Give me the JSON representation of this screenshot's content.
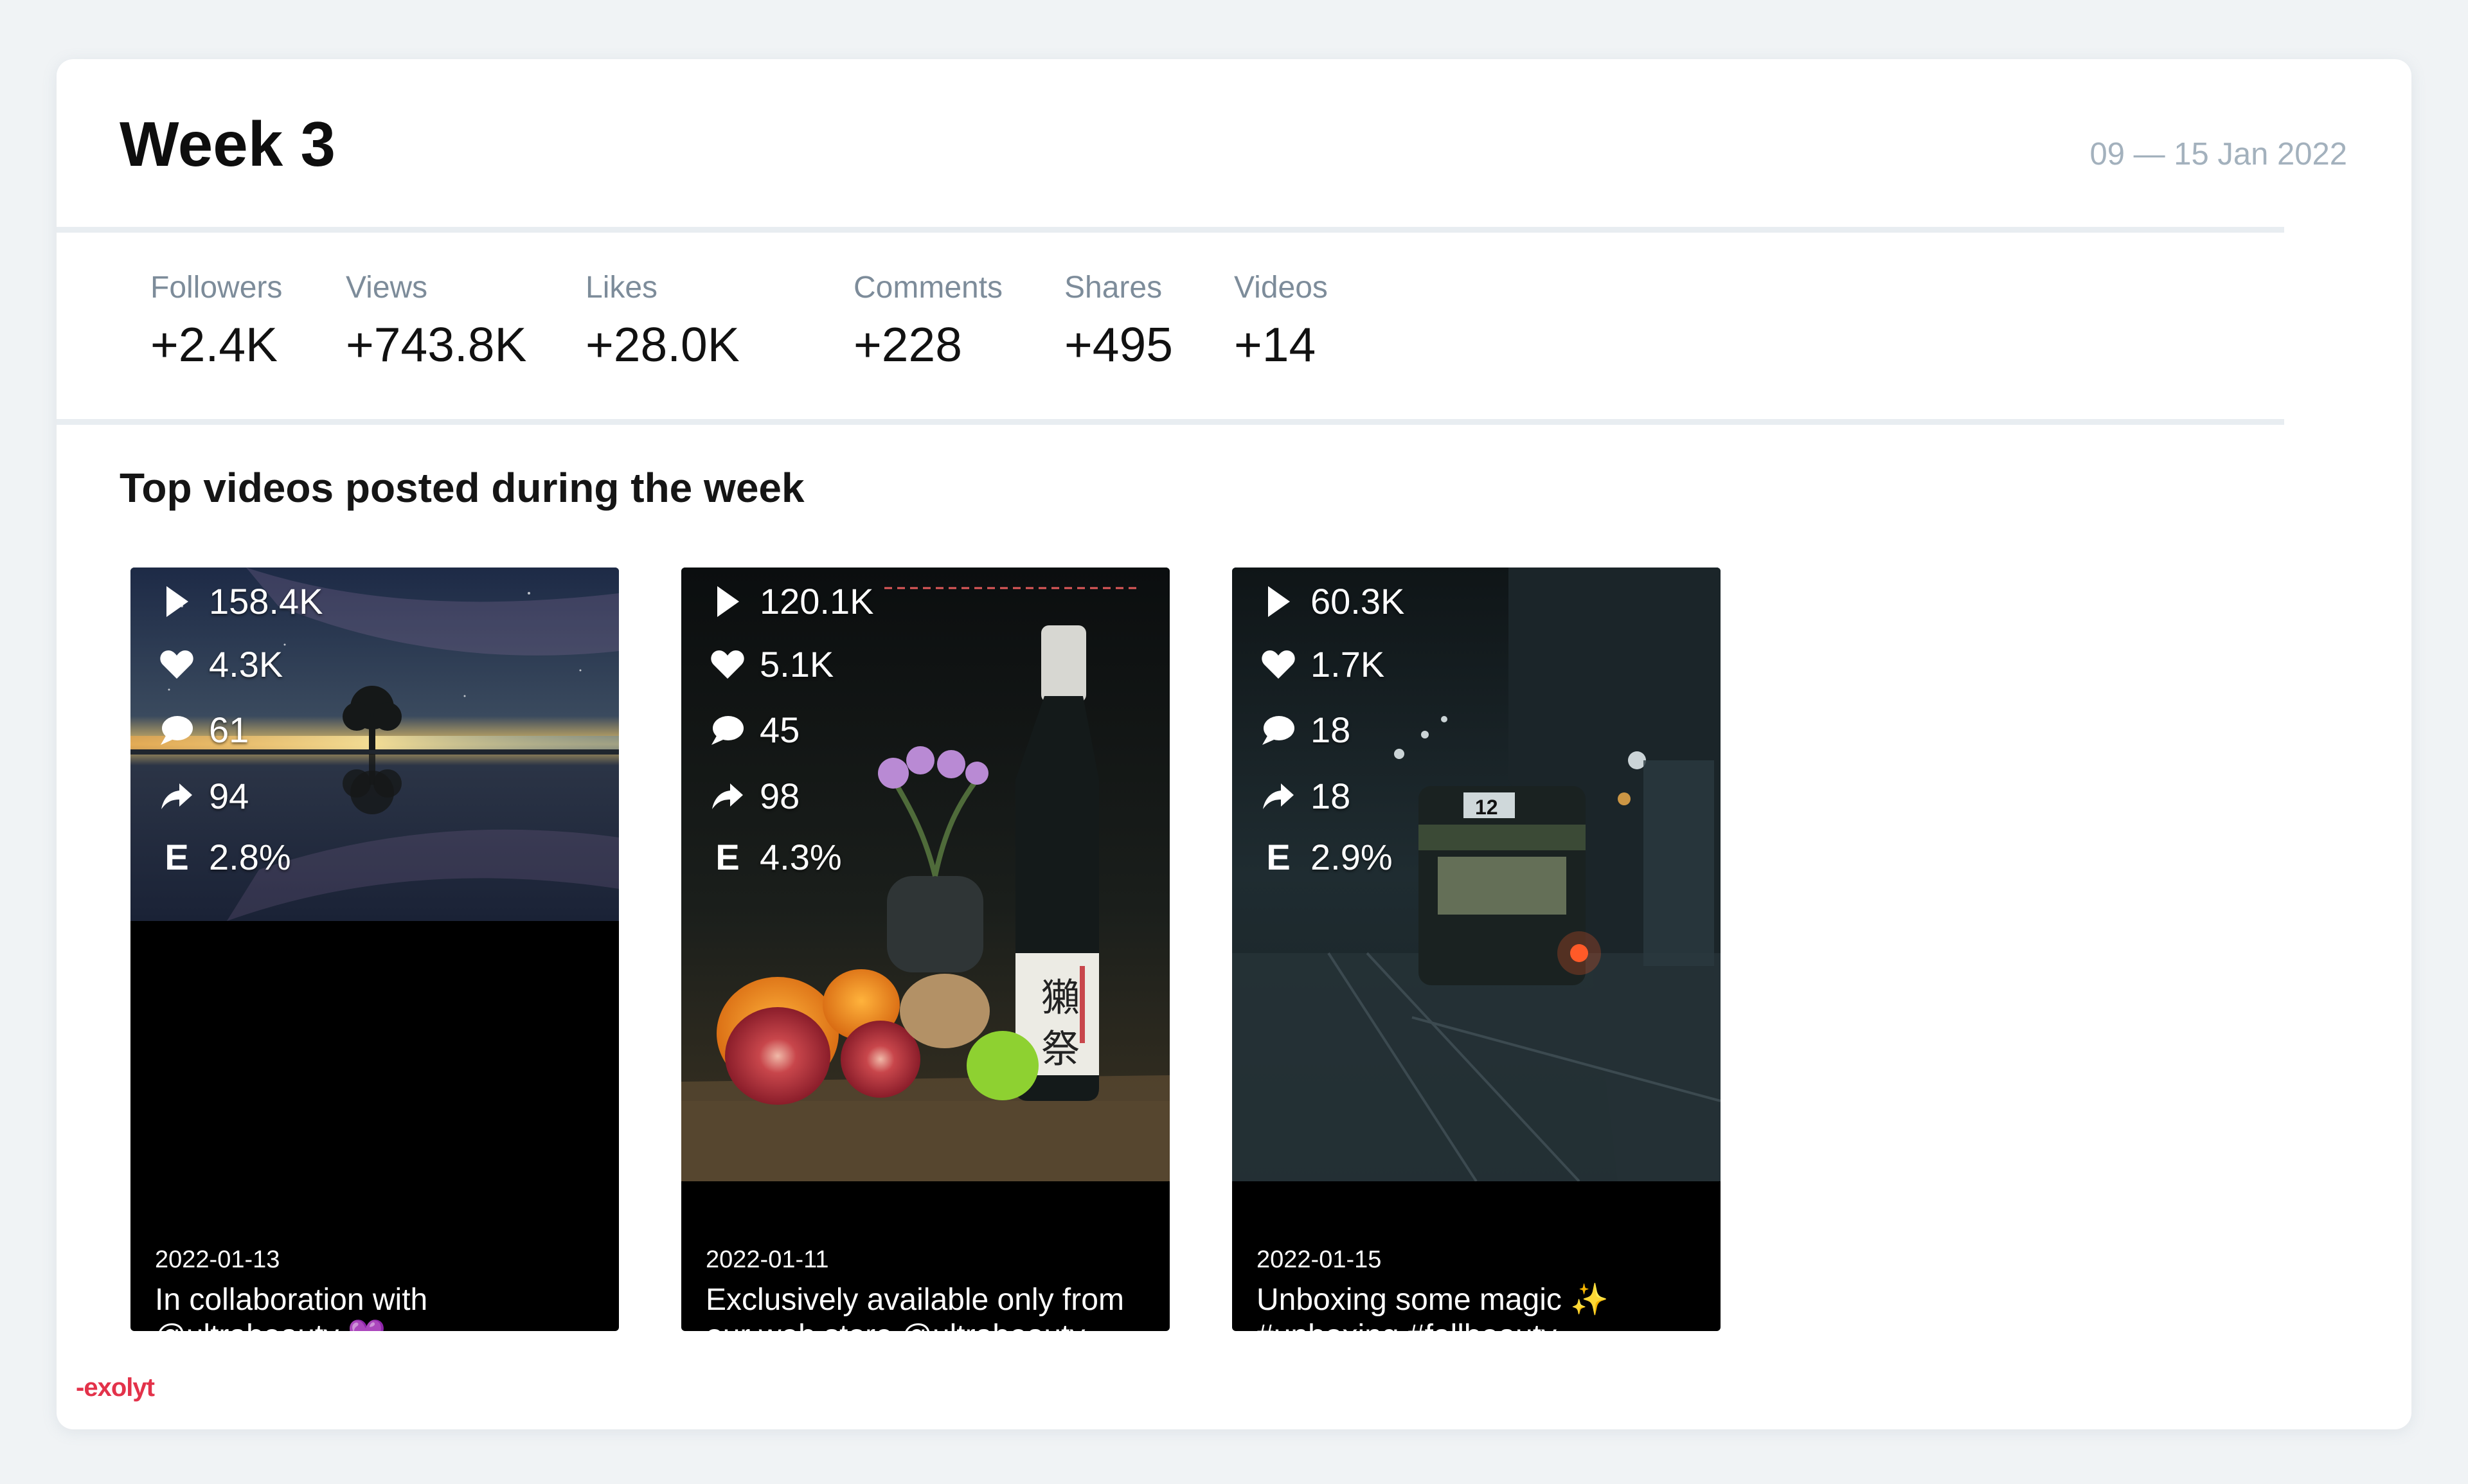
{
  "header": {
    "title": "Week 3",
    "date_range": "09 — 15 Jan 2022"
  },
  "stats": [
    {
      "label": "Followers",
      "value": "+2.4K"
    },
    {
      "label": "Views",
      "value": "+743.8K"
    },
    {
      "label": "Likes",
      "value": "+28.0K"
    },
    {
      "label": "Comments",
      "value": "+228"
    },
    {
      "label": "Shares",
      "value": "+495"
    },
    {
      "label": "Videos",
      "value": "+14"
    }
  ],
  "section_title": "Top videos posted during the week",
  "videos": [
    {
      "views": "158.4K",
      "likes": "4.3K",
      "comments": "61",
      "shares": "94",
      "engagement_label": "E",
      "engagement": "2.8%",
      "date": "2022-01-13",
      "caption": "In collaboration with @ultrabeauty 💜"
    },
    {
      "views": "120.1K",
      "likes": "5.1K",
      "comments": "45",
      "shares": "98",
      "engagement_label": "E",
      "engagement": "4.3%",
      "date": "2022-01-11",
      "caption": "Exclusively available only from our web store @ultrabeauty"
    },
    {
      "views": "60.3K",
      "likes": "1.7K",
      "comments": "18",
      "shares": "18",
      "engagement_label": "E",
      "engagement": "2.9%",
      "date": "2022-01-15",
      "caption": "Unboxing some magic ✨ #unboxing #fallbeauty"
    }
  ],
  "brand": {
    "logo_text": "-exolyt",
    "accent_color": "#e3324a"
  },
  "icons": [
    "play-icon",
    "heart-icon",
    "comment-icon",
    "share-icon"
  ]
}
